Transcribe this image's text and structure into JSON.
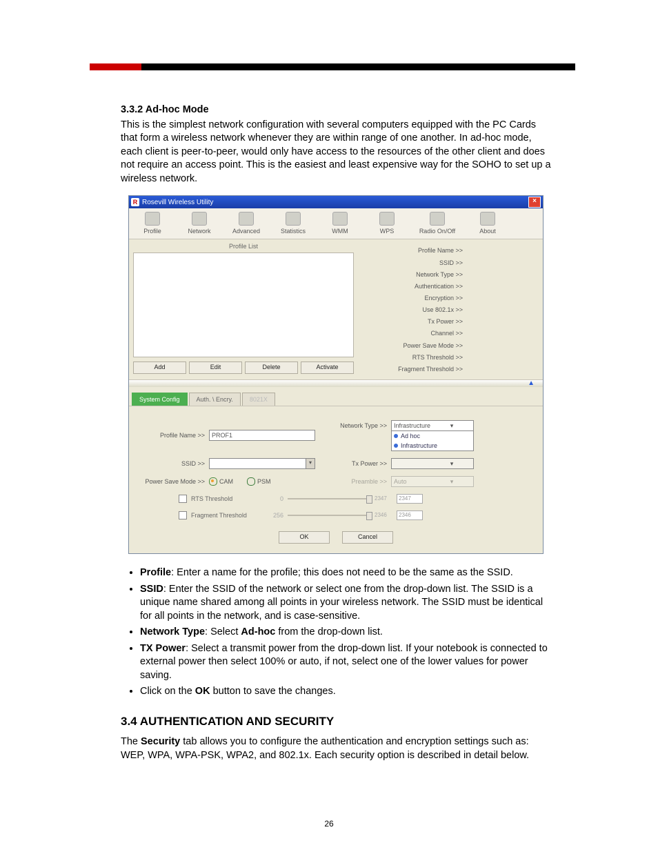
{
  "section": {
    "num_title": "3.3.2 Ad-hoc Mode",
    "intro": "This is the simplest network configuration with several computers equipped with the PC Cards that form a wireless network whenever they are within range of one another.  In ad-hoc mode, each client is peer-to-peer, would only have access to the resources of the other client and does not require an access point. This is the easiest and least expensive way for the SOHO to set up a wireless network."
  },
  "app": {
    "title": "Rosevill Wireless Utility",
    "tabs": [
      "Profile",
      "Network",
      "Advanced",
      "Statistics",
      "WMM",
      "WPS",
      "Radio On/Off",
      "About"
    ],
    "profile_list_label": "Profile List",
    "buttons": {
      "add": "Add",
      "edit": "Edit",
      "delete": "Delete",
      "activate": "Activate"
    },
    "info_labels": [
      "Profile Name >>",
      "SSID >>",
      "Network Type >>",
      "Authentication >>",
      "Encryption >>",
      "Use 802.1x >>",
      "Tx Power >>",
      "Channel >>",
      "Power Save Mode >>",
      "RTS Threshold >>",
      "Fragment Threshold >>"
    ],
    "cfg_tabs": {
      "system": "System Config",
      "auth": "Auth. \\ Encry.",
      "x": "8021X"
    },
    "fields": {
      "profile_name_label": "Profile Name >>",
      "profile_name_value": "PROF1",
      "ssid_label": "SSID >>",
      "ssid_value": "",
      "psm_label": "Power Save Mode >>",
      "cam": "CAM",
      "psm": "PSM",
      "network_type_label": "Network Type >>",
      "network_type_selected": "Infrastructure",
      "network_type_options": [
        "Ad hoc",
        "Infrastructure"
      ],
      "tx_power_label": "Tx Power >>",
      "preamble_label": "Preamble >>",
      "preamble_value": "Auto",
      "rts_label": "RTS Threshold",
      "rts_min": "0",
      "rts_max": "2347",
      "rts_value": "2347",
      "frag_label": "Fragment Threshold",
      "frag_min": "256",
      "frag_max": "2346",
      "frag_value": "2346",
      "ok": "OK",
      "cancel": "Cancel"
    }
  },
  "bullets": {
    "profile_b": "Profile",
    "profile_t": ": Enter a name for the profile; this does not need to be the same as the SSID.",
    "ssid_b": "SSID",
    "ssid_t": ": Enter the SSID of the network or select one from the drop-down list. The SSID is a unique name shared among all points in your wireless network. The SSID must be identical for all points in the network, and is case-sensitive.",
    "nt_b": "Network Type",
    "nt_t1": ": Select ",
    "nt_b2": "Ad-hoc",
    "nt_t2": " from the drop-down list.",
    "tx_b": "TX Power",
    "tx_t": ": Select a transmit power from the drop-down list. If your notebook is connected to external power then select 100% or auto, if not, select one of the lower values for power saving.",
    "ok_t1": "Click on the ",
    "ok_b": "OK",
    "ok_t2": " button to save the changes."
  },
  "h2": "3.4 AUTHENTICATION AND SECURITY",
  "sec_para_pre": "The ",
  "sec_para_b": "Security",
  "sec_para_post": " tab allows you to configure the authentication and encryption settings such as: WEP, WPA, WPA-PSK, WPA2, and 802.1x. Each security option is described in detail below.",
  "page_number": "26"
}
